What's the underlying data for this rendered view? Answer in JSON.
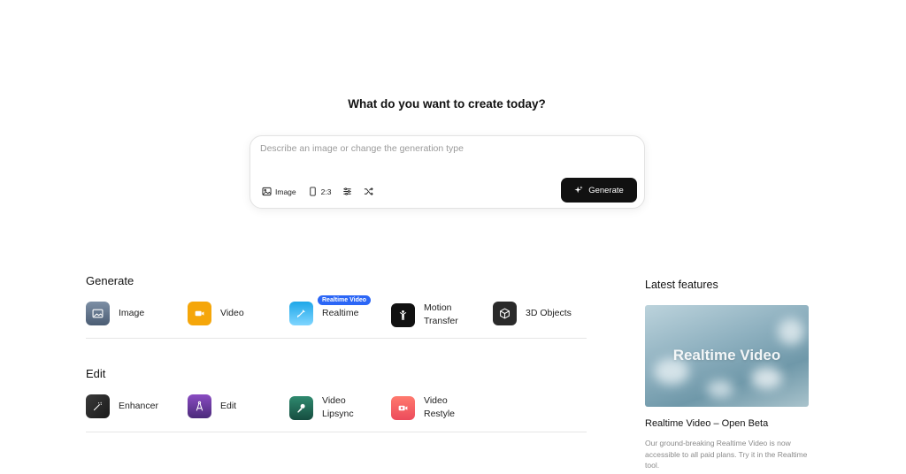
{
  "headline": "What do you want to create today?",
  "prompt": {
    "placeholder": "Describe an image or change the generation type",
    "value": "",
    "tools": {
      "type_label": "Image",
      "ratio_label": "2:3"
    },
    "generate_label": "Generate"
  },
  "generate_section": {
    "title": "Generate",
    "badge": "Realtime Video",
    "items": [
      {
        "label": "Image",
        "icon": "image-icon",
        "color": "#5b6f86"
      },
      {
        "label": "Video",
        "icon": "video-camera-icon",
        "color": "#f5a60a"
      },
      {
        "label": "Realtime",
        "icon": "brush-icon",
        "color": "#29b6f6"
      },
      {
        "label": "Motion Transfer",
        "icon": "person-icon",
        "color": "#111111"
      },
      {
        "label": "3D Objects",
        "icon": "cube-icon",
        "color": "#2a2a2a"
      }
    ]
  },
  "edit_section": {
    "title": "Edit",
    "items": [
      {
        "label": "Enhancer",
        "icon": "magic-wand-icon",
        "color": "#2b2b2b"
      },
      {
        "label": "Edit",
        "icon": "compass-icon",
        "color": "#6b3fa0"
      },
      {
        "label": "Video Lipsync",
        "icon": "microphone-icon",
        "color": "#1f6b57"
      },
      {
        "label": "Video Restyle",
        "icon": "video-restyle-icon",
        "color": "#f25a5a"
      }
    ]
  },
  "latest": {
    "title": "Latest features",
    "image_text": "Realtime Video",
    "name": "Realtime Video – Open Beta",
    "description": "Our ground-breaking Realtime Video is now accessible to all paid plans. Try it in the Realtime tool."
  }
}
